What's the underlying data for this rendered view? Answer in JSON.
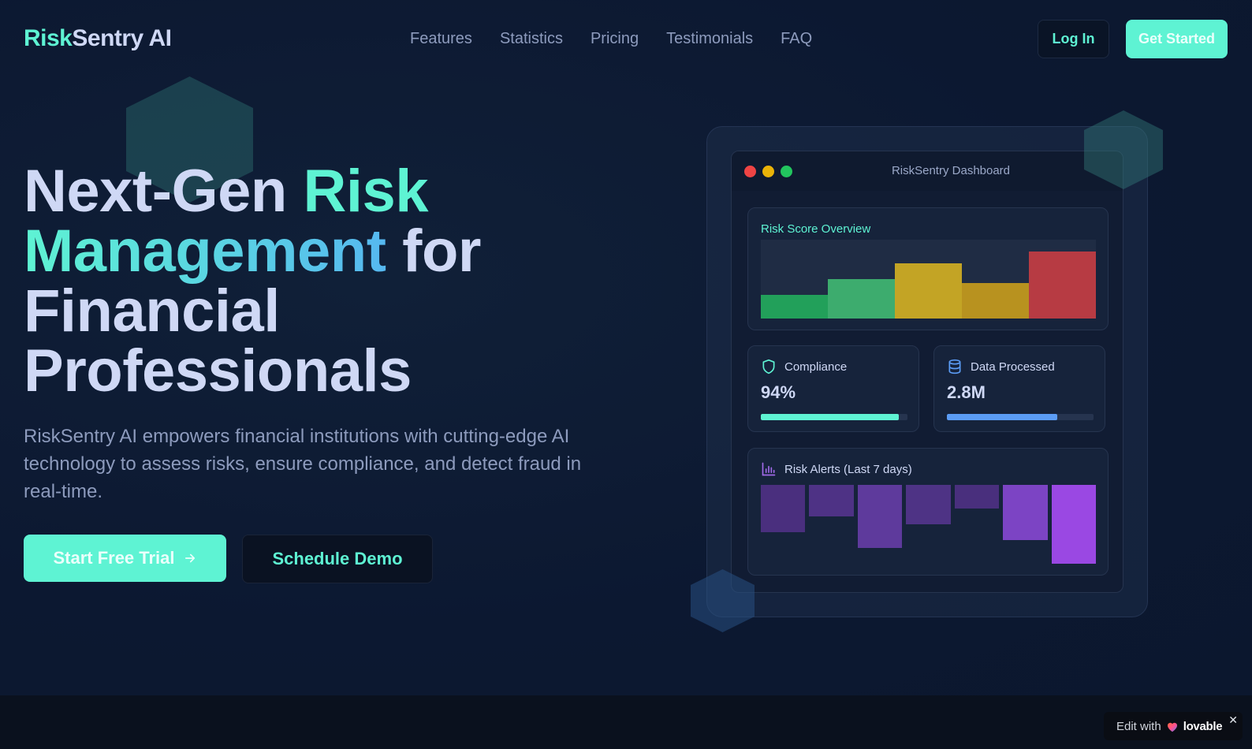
{
  "brand": {
    "name_part1": "Risk",
    "name_part2": "Sentry AI"
  },
  "nav": {
    "items": [
      "Features",
      "Statistics",
      "Pricing",
      "Testimonials",
      "FAQ"
    ]
  },
  "header": {
    "login_label": "Log In",
    "get_started_label": "Get Started"
  },
  "hero": {
    "title_part1": "Next-Gen ",
    "title_part2": "Risk",
    "title_part3": "Management",
    "title_part4": " for Financial Professionals",
    "subtitle": "RiskSentry AI empowers financial institutions with cutting-edge AI technology to assess risks, ensure compliance, and detect fraud in real-time.",
    "trial_label": "Start Free Trial",
    "trial_icon": "arrow-right-icon",
    "demo_label": "Schedule Demo"
  },
  "dashboard": {
    "window_title": "RiskSentry Dashboard",
    "window_dots": [
      "#ef4444",
      "#eab308",
      "#22c55e"
    ],
    "risk_overview": {
      "label": "Risk Score Overview",
      "bars": [
        {
          "level": 0.3,
          "color": "#22a05a"
        },
        {
          "level": 0.5,
          "color": "#3dac6e"
        },
        {
          "level": 0.7,
          "color": "#c3a425"
        },
        {
          "level": 0.45,
          "color": "#b8921f"
        },
        {
          "level": 0.85,
          "color": "#b73b43"
        }
      ]
    },
    "compliance": {
      "label": "Compliance",
      "icon": "shield-icon",
      "value": "94%",
      "progress": 0.94,
      "color": "#5ef3d3"
    },
    "data_processed": {
      "label": "Data Processed",
      "icon": "database-icon",
      "value": "2.8M",
      "progress": 0.75,
      "color": "#5b9cf5"
    },
    "risk_alerts": {
      "label": "Risk Alerts (Last 7 days)",
      "icon": "bar-chart-icon",
      "bars": [
        {
          "level": 0.6,
          "color": "#4a2f7e"
        },
        {
          "level": 0.4,
          "color": "#4e3285"
        },
        {
          "level": 0.8,
          "color": "#5e3a9c"
        },
        {
          "level": 0.5,
          "color": "#4e3385"
        },
        {
          "level": 0.3,
          "color": "#492f7d"
        },
        {
          "level": 0.7,
          "color": "#7c44c4"
        },
        {
          "level": 1.0,
          "color": "#9a48e3"
        }
      ]
    }
  },
  "badge": {
    "prefix": "Edit with",
    "brand": "lovable",
    "close": "✕"
  }
}
